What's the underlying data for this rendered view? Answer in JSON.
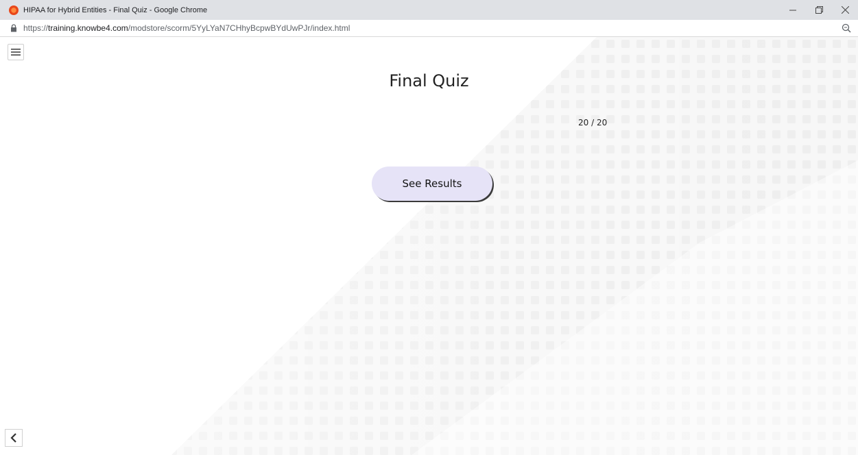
{
  "window": {
    "title": "HIPAA for Hybrid Entities - Final Quiz - Google Chrome",
    "app_icon": "chrome-app-icon",
    "controls": [
      "minimize-icon",
      "restore-icon",
      "close-icon"
    ]
  },
  "address_bar": {
    "url_scheme": "https://",
    "url_host": "training.knowbe4.com",
    "url_path": "/modstore/scorm/5YyLYaN7CHhyBcpwBYdUwPJr/index.html",
    "lock_icon": "lock-icon",
    "zoom_icon": "zoom-icon"
  },
  "page": {
    "menu_icon": "hamburger-menu-icon",
    "title": "Final Quiz",
    "progress": "20 / 20",
    "results_button": "See Results",
    "back_icon": "chevron-left-icon",
    "accent_color": "#e6e3f7"
  }
}
